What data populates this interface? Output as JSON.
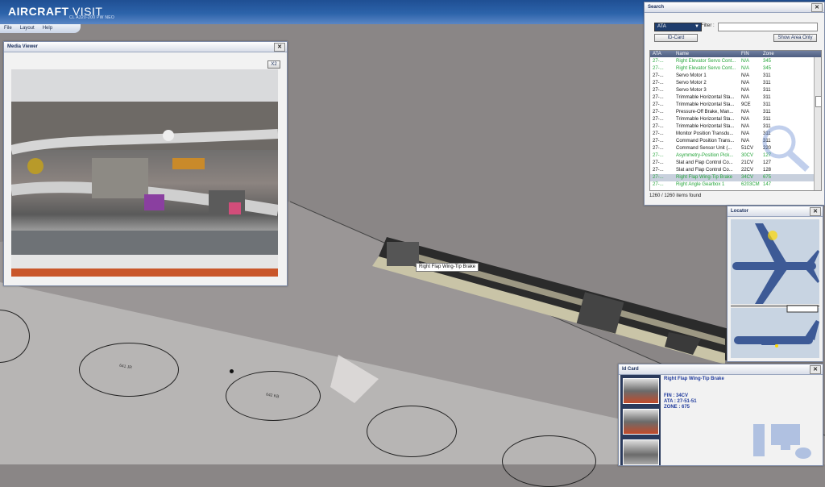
{
  "app": {
    "brand_left": "AIRCRAFT",
    "brand_right": "VISIT",
    "model": "CL A320-200 PW NEO"
  },
  "menu": [
    "File",
    "Layout",
    "Help"
  ],
  "media_viewer": {
    "title": "Media Viewer",
    "zoom_label": "X2"
  },
  "search": {
    "title": "Search",
    "dropdown_value": "ATA",
    "filter_label": "Filter :",
    "filter_value": "",
    "id_card_button": "ID-Card",
    "show_area_button": "Show Area Only",
    "columns": [
      "ATA",
      "Name",
      "FIN",
      "Zone"
    ],
    "rows": [
      {
        "ata": "27-...",
        "name": "Right Elevator Servo Cont...",
        "fin": "N/A",
        "zone": "345",
        "style": "green"
      },
      {
        "ata": "27-...",
        "name": "Right Elevator Servo Cont...",
        "fin": "N/A",
        "zone": "345",
        "style": "green"
      },
      {
        "ata": "27-...",
        "name": "Servo Motor 1",
        "fin": "N/A",
        "zone": "311",
        "style": "black"
      },
      {
        "ata": "27-...",
        "name": "Servo Motor 2",
        "fin": "N/A",
        "zone": "311",
        "style": "black"
      },
      {
        "ata": "27-...",
        "name": "Servo Motor 3",
        "fin": "N/A",
        "zone": "311",
        "style": "black"
      },
      {
        "ata": "27-...",
        "name": "Trimmable Horizontal Sta...",
        "fin": "N/A",
        "zone": "311",
        "style": "black"
      },
      {
        "ata": "27-...",
        "name": "Trimmable Horizontal Sta...",
        "fin": "9CE",
        "zone": "311",
        "style": "black"
      },
      {
        "ata": "27-...",
        "name": "Pressure-Off Brake, Man...",
        "fin": "N/A",
        "zone": "311",
        "style": "black"
      },
      {
        "ata": "27-...",
        "name": "Trimmable Horizontal Sta...",
        "fin": "N/A",
        "zone": "311",
        "style": "black"
      },
      {
        "ata": "27-...",
        "name": "Trimmable Horizontal Sta...",
        "fin": "N/A",
        "zone": "311",
        "style": "black"
      },
      {
        "ata": "27-...",
        "name": "Monitor Position Transdu...",
        "fin": "N/A",
        "zone": "311",
        "style": "black"
      },
      {
        "ata": "27-...",
        "name": "Command Position Trans...",
        "fin": "N/A",
        "zone": "311",
        "style": "black"
      },
      {
        "ata": "27-...",
        "name": "Command Sensor Unit (...",
        "fin": "51CV",
        "zone": "220",
        "style": "black"
      },
      {
        "ata": "27-...",
        "name": "Asymmetry-Position Pick...",
        "fin": "30CV",
        "zone": "127",
        "style": "green"
      },
      {
        "ata": "27-...",
        "name": "Slat and Flap Control Co...",
        "fin": "21CV",
        "zone": "127",
        "style": "black"
      },
      {
        "ata": "27-...",
        "name": "Slat and Flap Control Co...",
        "fin": "22CV",
        "zone": "128",
        "style": "black"
      },
      {
        "ata": "27-...",
        "name": "Right Flap Wing-Tip Brake",
        "fin": "34CV",
        "zone": "675",
        "style": "sel"
      },
      {
        "ata": "27-...",
        "name": "Right Angle Gearbox 1",
        "fin": "6203CM",
        "zone": "147",
        "style": "green"
      }
    ],
    "count": "1260 / 1260 items found"
  },
  "locator": {
    "title": "Locator"
  },
  "tooltip": "Right Flap Wing-Tip Brake",
  "id_card": {
    "title": "Id Card",
    "name": "Right Flap Wing-Tip Brake",
    "fin": "FIN : 34CV",
    "ata": "ATA : 27-51-51",
    "zone": "ZONE : 675"
  },
  "zone_labels": [
    "641 JR",
    "642 KB"
  ],
  "colors": {
    "brand_blue": "#1f4f93",
    "panel_title": "#1b2f5c",
    "green_row": "#25a53a",
    "id_text": "#1f3a9c"
  }
}
